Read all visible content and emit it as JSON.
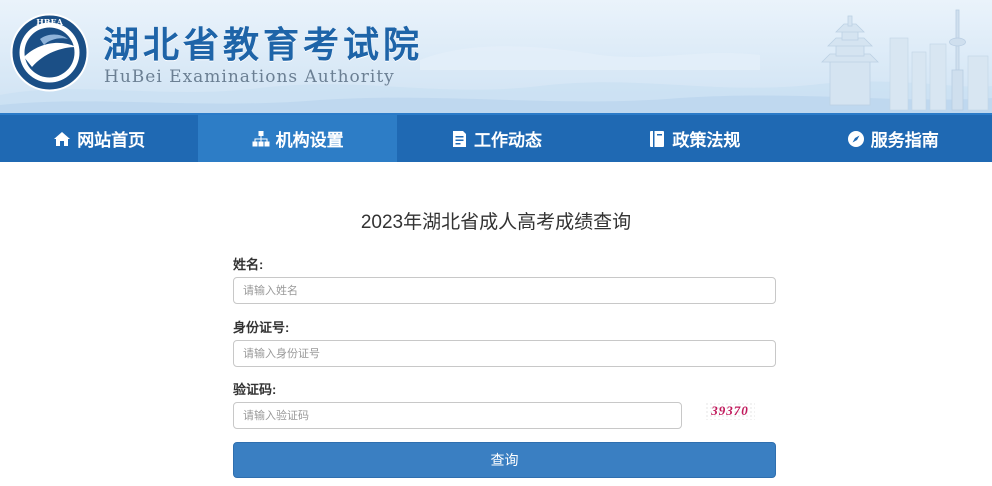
{
  "header": {
    "site_title": "湖北省教育考试院",
    "site_subtitle": "HuBei Examinations Authority",
    "emblem_text": "HBEA"
  },
  "nav": {
    "items": [
      {
        "label": "网站首页",
        "icon": "home-icon",
        "active": false
      },
      {
        "label": "机构设置",
        "icon": "org-chart-icon",
        "active": true
      },
      {
        "label": "工作动态",
        "icon": "document-icon",
        "active": false
      },
      {
        "label": "政策法规",
        "icon": "book-icon",
        "active": false
      },
      {
        "label": "服务指南",
        "icon": "compass-icon",
        "active": false
      }
    ]
  },
  "main": {
    "page_title": "2023年湖北省成人高考成绩查询",
    "form": {
      "name_label": "姓名:",
      "name_placeholder": "请输入姓名",
      "name_value": "",
      "id_label": "身份证号:",
      "id_placeholder": "请输入身份证号",
      "id_value": "",
      "captcha_label": "验证码:",
      "captcha_placeholder": "请输入验证码",
      "captcha_value": "",
      "captcha_code": "39370",
      "submit_label": "查询"
    }
  },
  "colors": {
    "nav_bg": "#1f69b3",
    "nav_active_bg": "#2d7dc6",
    "title_blue": "#1e64a8",
    "button_bg": "#3a7fc2",
    "captcha_text": "#c1185b"
  }
}
